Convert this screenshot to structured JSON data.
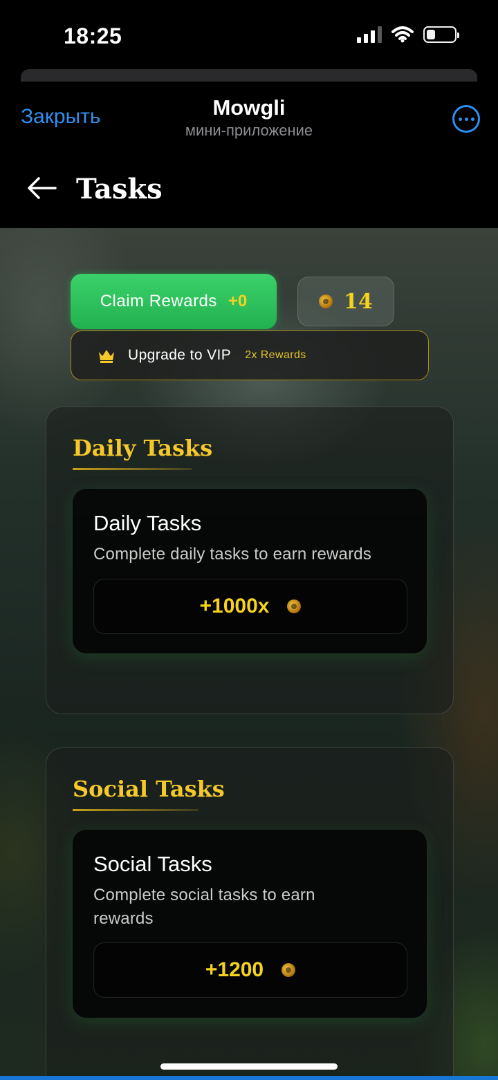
{
  "status_bar": {
    "time": "18:25"
  },
  "telegram_header": {
    "close_label": "Закрыть",
    "app_name": "Mowgli",
    "app_subtitle": "мини-приложение"
  },
  "app_header": {
    "title": "Tasks"
  },
  "claim": {
    "label": "Claim Rewards",
    "amount": "+0"
  },
  "balance": {
    "value": "14"
  },
  "vip": {
    "label": "Upgrade to VIP",
    "bonus": "2x Rewards"
  },
  "sections": [
    {
      "title": "Daily Tasks",
      "card_title": "Daily Tasks",
      "card_description": "Complete daily tasks to earn rewards",
      "reward": "+1000x"
    },
    {
      "title": "Social Tasks",
      "card_title": "Social Tasks",
      "card_description": "Complete social tasks to earn rewards",
      "reward": "+1200"
    }
  ],
  "colors": {
    "accent_gold": "#f5d21e",
    "claim_green": "#22b14f",
    "telegram_blue": "#2f8ff0"
  },
  "icons": [
    "signal-icon",
    "wifi-icon",
    "battery-icon",
    "more-icon",
    "back-arrow-icon",
    "coin-icon",
    "crown-icon"
  ],
  "battery_level": 0.3
}
